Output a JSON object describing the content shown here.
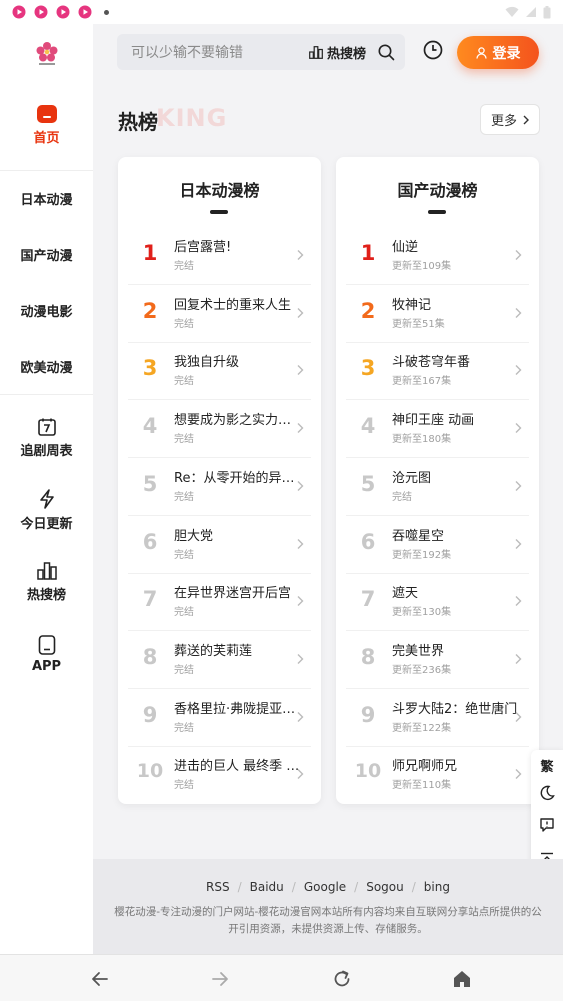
{
  "status_bar": {
    "icons": [
      "play-icon",
      "play-icon",
      "play-icon",
      "play-icon"
    ],
    "right_icons": [
      "wifi-icon",
      "signal-icon",
      "battery-icon"
    ]
  },
  "sidebar": {
    "logo": "sakura-logo",
    "items": [
      {
        "label": "首页",
        "icon": "home-icon",
        "active": true
      },
      {
        "label": "日本动漫"
      },
      {
        "label": "国产动漫"
      },
      {
        "label": "动漫电影"
      },
      {
        "label": "欧美动漫"
      },
      {
        "label": "追剧周表",
        "icon": "calendar-icon"
      },
      {
        "label": "今日更新",
        "icon": "lightning-icon"
      },
      {
        "label": "热搜榜",
        "icon": "chart-icon"
      },
      {
        "label": "APP",
        "icon": "phone-icon"
      }
    ]
  },
  "header": {
    "search_placeholder": "可以少输不要输错",
    "hot_label": "热搜榜",
    "login_label": "登录"
  },
  "section": {
    "title": "热榜",
    "ghost": "KING",
    "more_label": "更多"
  },
  "rank_colors": [
    "#e0201a",
    "#f26a1b",
    "#f5a623"
  ],
  "lists": [
    {
      "title": "日本动漫榜",
      "items": [
        {
          "rank": "1",
          "title": "后宫露营!",
          "sub": "完结"
        },
        {
          "rank": "2",
          "title": "回复术士的重来人生",
          "sub": "完结"
        },
        {
          "rank": "3",
          "title": "我独自升级",
          "sub": "完结"
        },
        {
          "rank": "4",
          "title": "想要成为影之实力者…",
          "sub": "完结"
        },
        {
          "rank": "5",
          "title": "Re：从零开始的异世…",
          "sub": "完结"
        },
        {
          "rank": "6",
          "title": "胆大党",
          "sub": "完结"
        },
        {
          "rank": "7",
          "title": "在异世界迷宫开后宫",
          "sub": "完结"
        },
        {
          "rank": "8",
          "title": "葬送的芙莉莲",
          "sub": "完结"
        },
        {
          "rank": "9",
          "title": "香格里拉·弗陇提亚~…",
          "sub": "完结"
        },
        {
          "rank": "10",
          "title": "进击的巨人 最终季 P…",
          "sub": "完结"
        }
      ]
    },
    {
      "title": "国产动漫榜",
      "items": [
        {
          "rank": "1",
          "title": "仙逆",
          "sub": "更新至109集"
        },
        {
          "rank": "2",
          "title": "牧神记",
          "sub": "更新至51集"
        },
        {
          "rank": "3",
          "title": "斗破苍穹年番",
          "sub": "更新至167集"
        },
        {
          "rank": "4",
          "title": "神印王座 动画",
          "sub": "更新至180集"
        },
        {
          "rank": "5",
          "title": "沧元图",
          "sub": "完结"
        },
        {
          "rank": "6",
          "title": "吞噬星空",
          "sub": "更新至192集"
        },
        {
          "rank": "7",
          "title": "遮天",
          "sub": "更新至130集"
        },
        {
          "rank": "8",
          "title": "完美世界",
          "sub": "更新至236集"
        },
        {
          "rank": "9",
          "title": "斗罗大陆2：绝世唐门",
          "sub": "更新至122集"
        },
        {
          "rank": "10",
          "title": "师兄啊师兄",
          "sub": "更新至110集"
        }
      ]
    }
  ],
  "float_tools": {
    "traditional_label": "繁"
  },
  "footer": {
    "links": [
      "RSS",
      "Baidu",
      "Google",
      "Sogou",
      "bing"
    ],
    "text": "樱花动漫-专注动漫的门户网站-樱花动漫官网本站所有内容均来自互联网分享站点所提供的公开引用资源，未提供资源上传、存储服务。"
  }
}
